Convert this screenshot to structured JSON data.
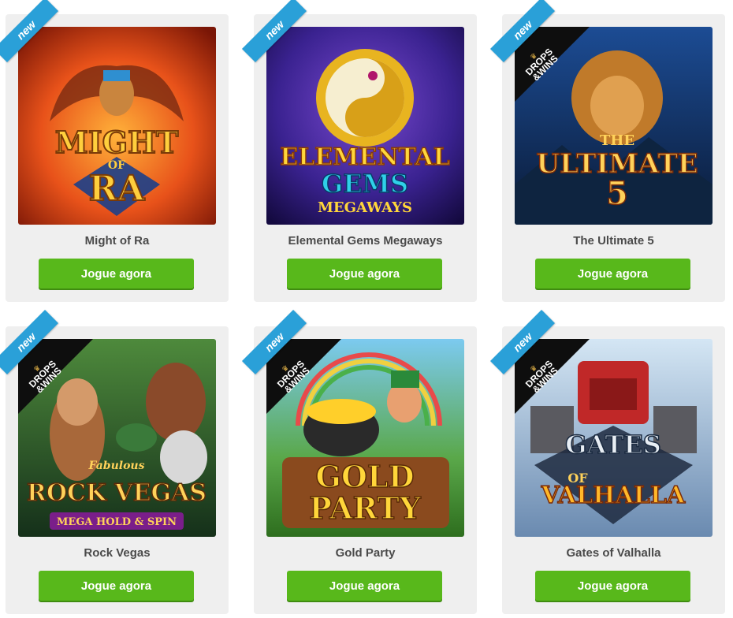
{
  "cards": [
    {
      "title": "Might of Ra",
      "button": "Jogue agora",
      "badge": "new",
      "logo": [
        "MIGHT",
        "OF",
        "RA"
      ],
      "drops_wins": false,
      "colors": {
        "bg1": "#f0701a",
        "bg2": "#7a1606"
      }
    },
    {
      "title": "Elemental Gems Megaways",
      "button": "Jogue agora",
      "badge": "new",
      "logo": [
        "ELEMENTAL",
        "GEMS",
        "MEGAWAYS"
      ],
      "drops_wins": false,
      "colors": {
        "bg1": "#4a2a9c",
        "bg2": "#1a0f4a"
      }
    },
    {
      "title": "The Ultimate 5",
      "button": "Jogue agora",
      "badge": "new",
      "logo": [
        "THE",
        "ULTIMATE",
        "5"
      ],
      "drops_wins": true,
      "colors": {
        "bg1": "#2f6bb8",
        "bg2": "#0b1c3a"
      }
    },
    {
      "title": "Rock Vegas",
      "button": "Jogue agora",
      "badge": "new",
      "logo": [
        "Fabulous",
        "ROCK VEGAS",
        "MEGA HOLD & SPIN"
      ],
      "drops_wins": true,
      "colors": {
        "bg1": "#3c7a3a",
        "bg2": "#15301a"
      }
    },
    {
      "title": "Gold Party",
      "button": "Jogue agora",
      "badge": "new",
      "logo": [
        "GOLD",
        "PARTY"
      ],
      "drops_wins": true,
      "colors": {
        "bg1": "#6cc0e8",
        "bg2": "#2e6e1e"
      }
    },
    {
      "title": "Gates of Valhalla",
      "button": "Jogue agora",
      "badge": "new",
      "logo": [
        "GATES",
        "OF",
        "VALHALLA"
      ],
      "drops_wins": true,
      "colors": {
        "bg1": "#bfd9ee",
        "bg2": "#5c7fa6"
      }
    }
  ],
  "drops_wins_label": {
    "line1": "DROPS",
    "line2": "&WINS"
  },
  "accent": "#58b81b",
  "ribbon_color": "#2aa0d8"
}
